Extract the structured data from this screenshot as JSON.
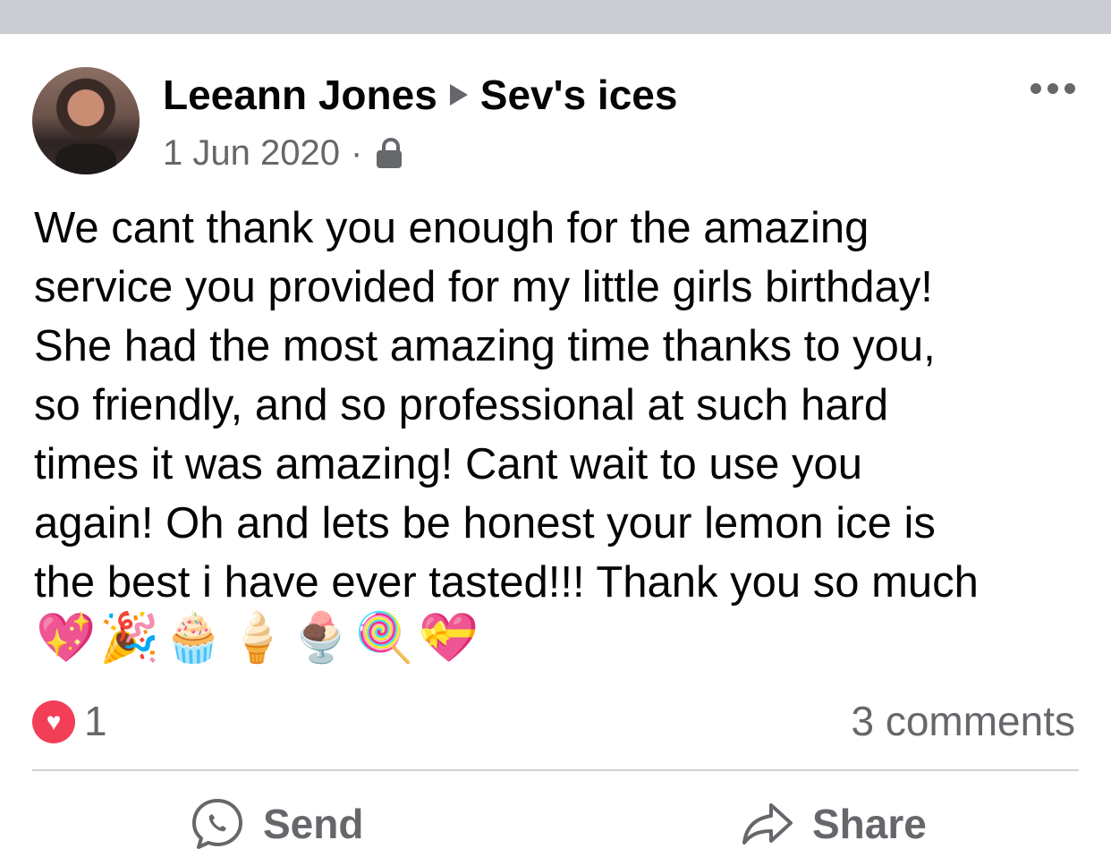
{
  "post": {
    "author": "Leeann Jones",
    "target_page": "Sev's ices",
    "date": "1 Jun 2020",
    "separator": "·",
    "privacy_icon": "lock-icon",
    "body": "We cant thank you enough for the amazing\nservice you provided for my little girls birthday!\nShe had the most amazing time thanks to you,\nso friendly, and so professional at such hard\ntimes it was amazing! Cant wait to use you\nagain! Oh and lets be honest your lemon ice is\nthe best i have ever tasted!!! Thank you so much",
    "emojis": [
      "💖",
      "🎉",
      "🧁",
      "🍦",
      "🍨",
      "🍭",
      "💝"
    ]
  },
  "stats": {
    "reaction_icon": "heart-reaction-icon",
    "reaction_count": "1",
    "comments": "3 comments"
  },
  "actions": {
    "send_label": "Send",
    "share_label": "Share"
  },
  "colors": {
    "top_bar": "#c9ccd1",
    "secondary_text": "#65676b",
    "heart": "#f33e58",
    "divider": "#ced0d4"
  }
}
